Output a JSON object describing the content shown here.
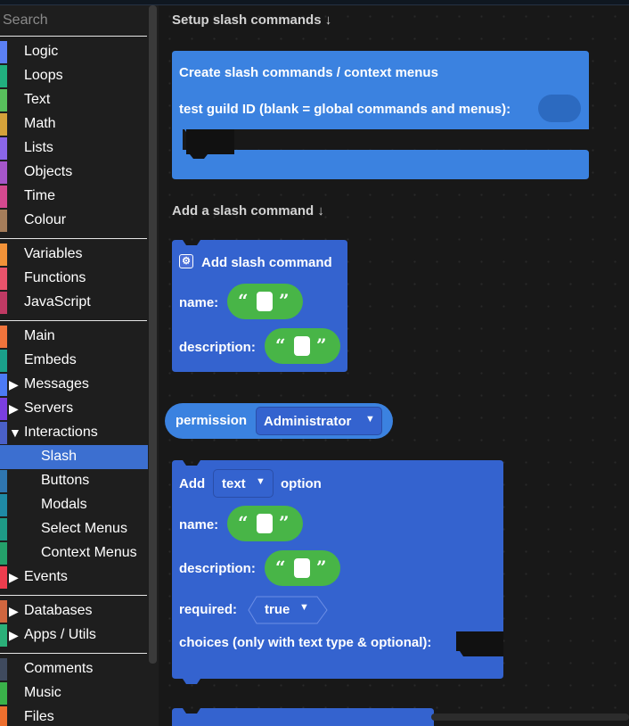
{
  "toolbox": {
    "search_placeholder": "Search",
    "categories": [
      {
        "label": "Logic",
        "color": "#5b80f5"
      },
      {
        "label": "Loops",
        "color": "#21b07f"
      },
      {
        "label": "Text",
        "color": "#58c05c"
      },
      {
        "label": "Math",
        "color": "#d5a23a"
      },
      {
        "label": "Lists",
        "color": "#8b66e8"
      },
      {
        "label": "Objects",
        "color": "#a556c9"
      },
      {
        "label": "Time",
        "color": "#d4498f"
      },
      {
        "label": "Colour",
        "color": "#a57d5a"
      },
      {
        "label": "Variables",
        "color": "#f29238"
      },
      {
        "label": "Functions",
        "color": "#e9536b"
      },
      {
        "label": "JavaScript",
        "color": "#c03a64"
      },
      {
        "label": "Main",
        "color": "#f0743c"
      },
      {
        "label": "Embeds",
        "color": "#1aa08a"
      },
      {
        "label": "Messages",
        "color": "#4c7af5",
        "arrow": "▶"
      },
      {
        "label": "Servers",
        "color": "#7b3ee0",
        "arrow": "▶"
      },
      {
        "label": "Interactions",
        "color": "#4a60c8",
        "arrow": "▼"
      },
      {
        "label": "Slash",
        "color": "#3c6fd0"
      },
      {
        "label": "Buttons",
        "color": "#2f76b0"
      },
      {
        "label": "Modals",
        "color": "#1f8aa5"
      },
      {
        "label": "Select Menus",
        "color": "#1e9a86"
      },
      {
        "label": "Context Menus",
        "color": "#24a16a"
      },
      {
        "label": "Events",
        "color": "#ee3d4e",
        "arrow": "▶"
      },
      {
        "label": "Databases",
        "color": "#d0663f",
        "arrow": "▶"
      },
      {
        "label": "Apps / Utils",
        "color": "#2bb079",
        "arrow": "▶"
      },
      {
        "label": "Comments",
        "color": "#3f4a5e"
      },
      {
        "label": "Music",
        "color": "#3ab24a"
      },
      {
        "label": "Files",
        "color": "#ee6f2e"
      }
    ]
  },
  "workspace": {
    "headers": {
      "setup": "Setup slash commands ↓",
      "add": "Add a slash command ↓"
    },
    "create_block": {
      "title": "Create slash commands / context menus",
      "guild_label": "test guild ID (blank = global commands and menus):"
    },
    "add_cmd_block": {
      "title": "Add slash command",
      "name_label": "name:",
      "description_label": "description:"
    },
    "permission_block": {
      "label": "permission",
      "value": "Administrator"
    },
    "option_block": {
      "add_label": "Add",
      "type_value": "text",
      "option_label": "option",
      "name_label": "name:",
      "description_label": "description:",
      "required_label": "required:",
      "required_value": "true",
      "choices_label": "choices (only with text type & optional):"
    },
    "colors": {
      "blue_block": "#3b82e0",
      "dark_blue_block": "#3463cf",
      "string_green": "#48b547"
    }
  }
}
